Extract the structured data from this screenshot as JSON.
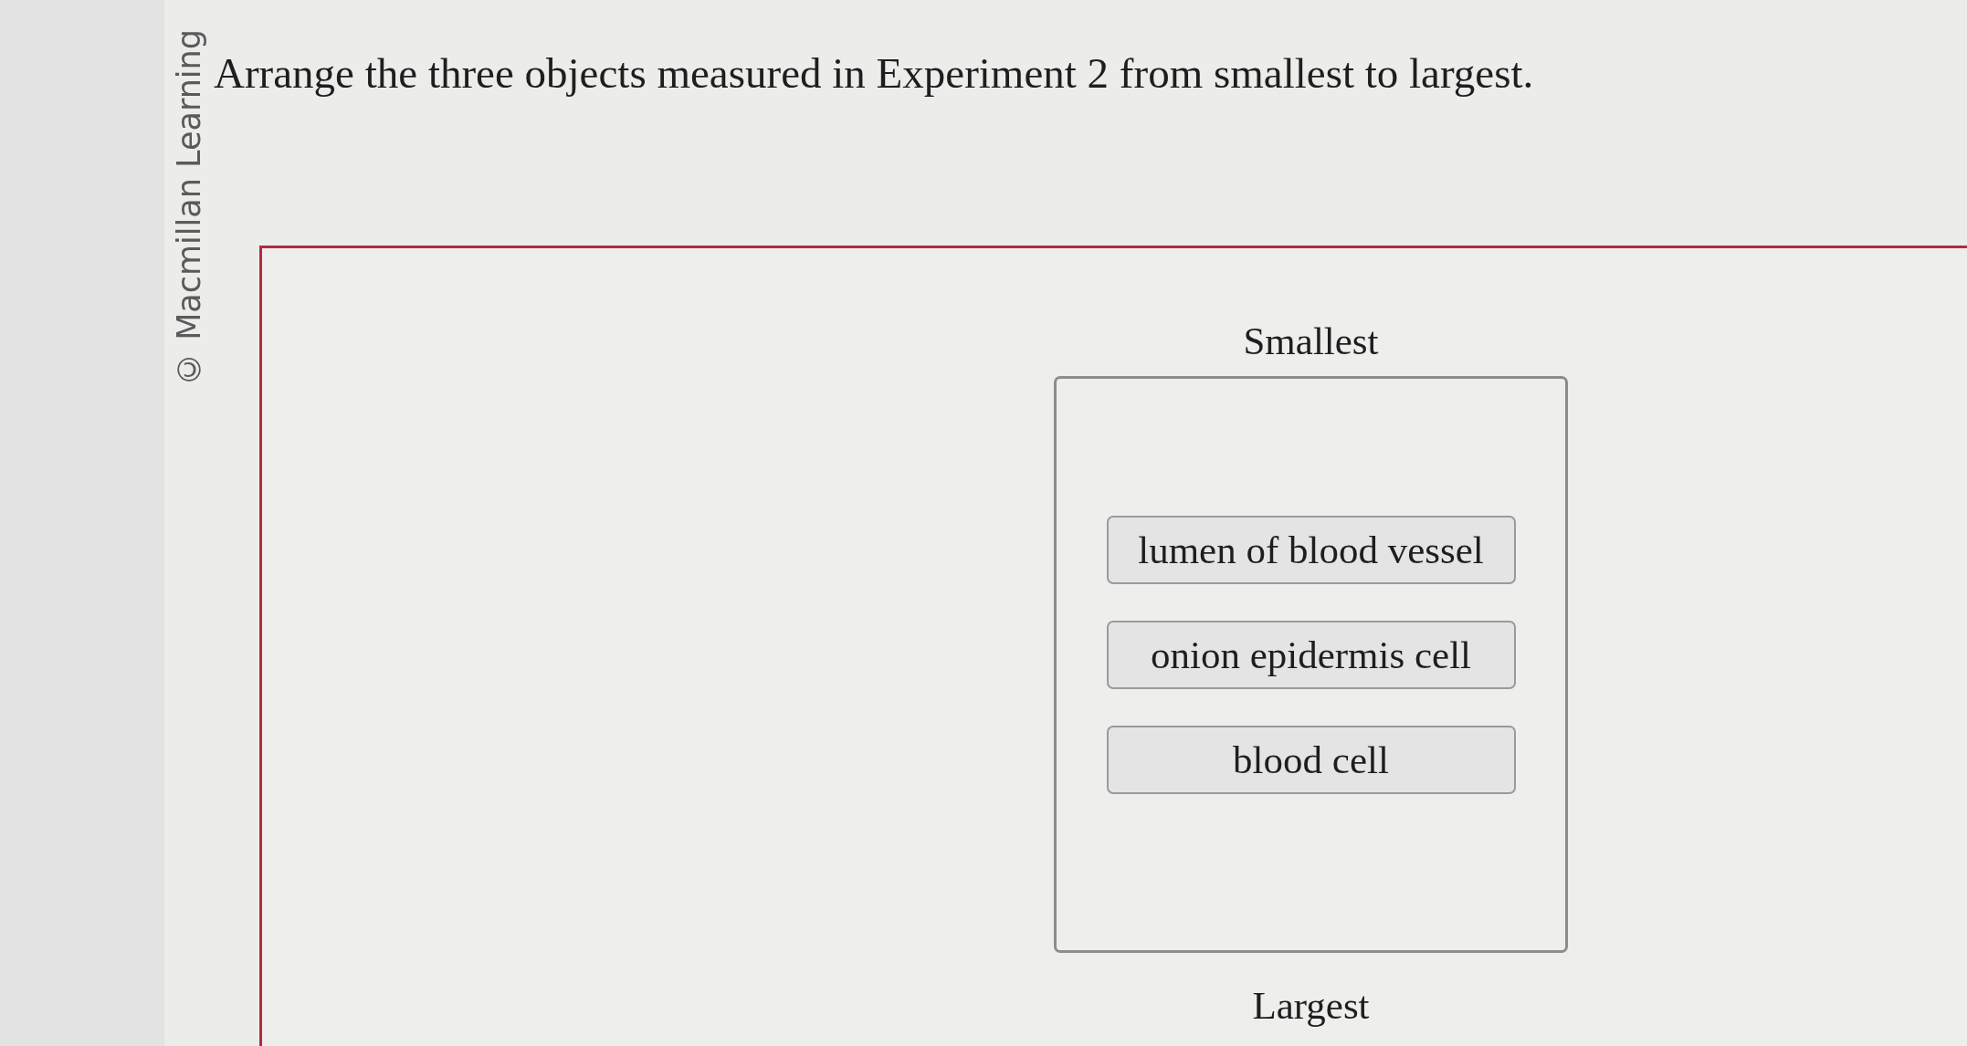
{
  "copyright": "© Macmillan Learning",
  "question": "Arrange the three objects measured in Experiment 2 from smallest to largest.",
  "ranking": {
    "top_label": "Smallest",
    "items": [
      "lumen of blood vessel",
      "onion epidermis cell",
      "blood cell"
    ],
    "bottom_label": "Largest"
  }
}
